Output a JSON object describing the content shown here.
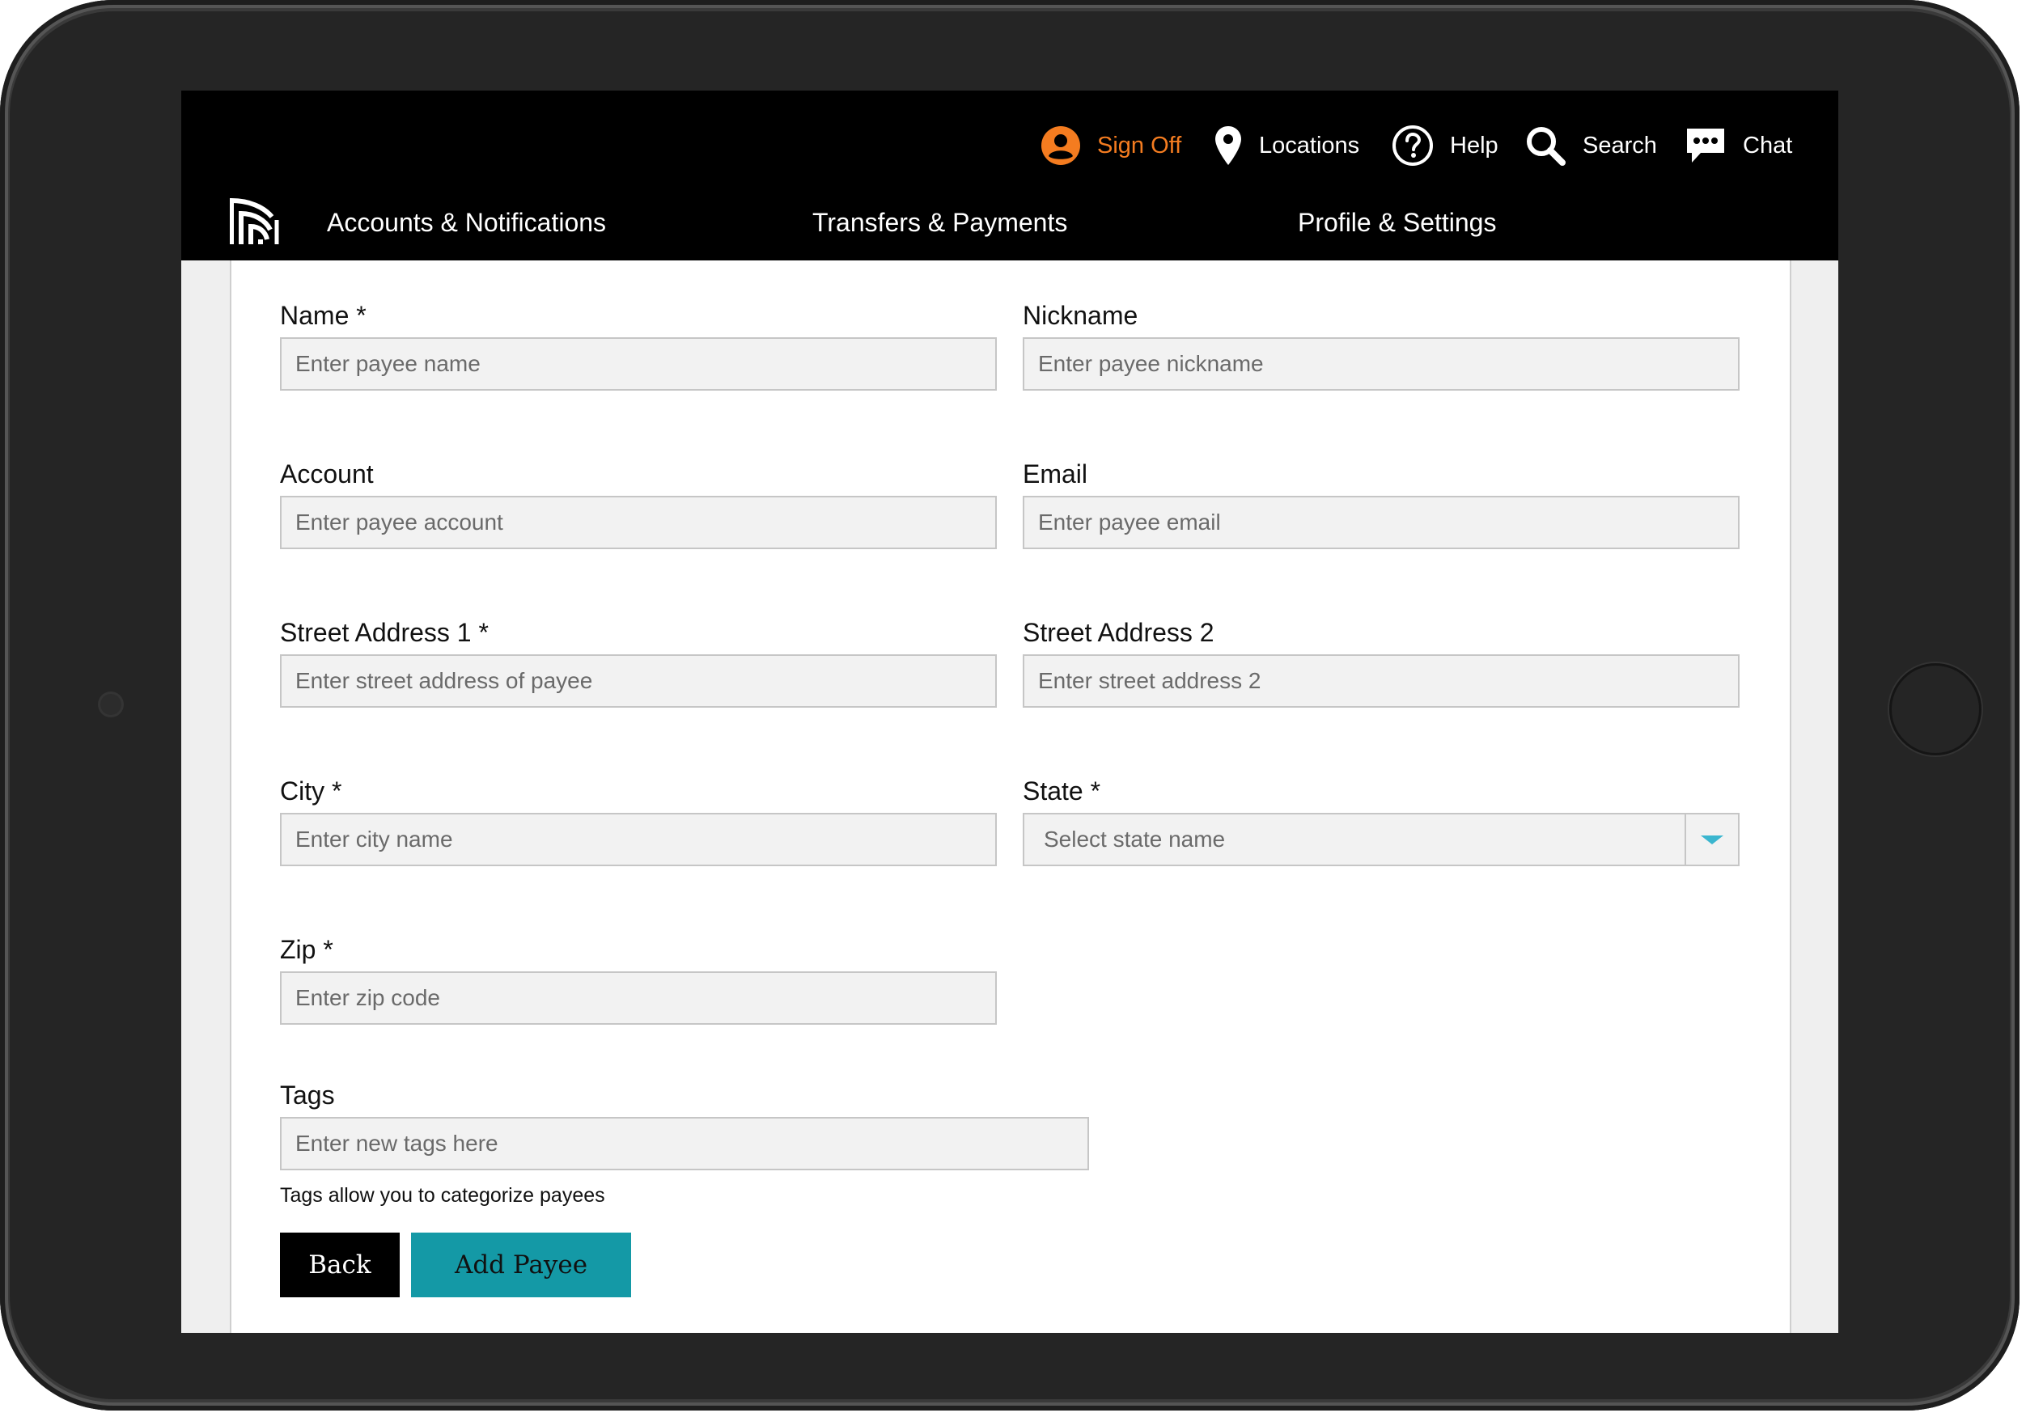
{
  "header": {
    "utility": {
      "sign_off": "Sign Off",
      "locations": "Locations",
      "help": "Help",
      "search": "Search",
      "chat": "Chat"
    },
    "nav": [
      {
        "label": "Accounts & Notifications"
      },
      {
        "label": "Transfers & Payments"
      },
      {
        "label": "Profile & Settings"
      }
    ]
  },
  "form": {
    "name": {
      "label": "Name *",
      "placeholder": "Enter payee name",
      "value": ""
    },
    "nickname": {
      "label": "Nickname",
      "placeholder": "Enter payee nickname",
      "value": ""
    },
    "account": {
      "label": "Account",
      "placeholder": "Enter payee account",
      "value": ""
    },
    "email": {
      "label": "Email",
      "placeholder": "Enter payee email",
      "value": ""
    },
    "street1": {
      "label": "Street Address 1 *",
      "placeholder": "Enter street address of payee",
      "value": ""
    },
    "street2": {
      "label": "Street Address 2",
      "placeholder": "Enter street address 2",
      "value": ""
    },
    "city": {
      "label": "City *",
      "placeholder": "Enter city name",
      "value": ""
    },
    "state": {
      "label": "State *",
      "selected": "Select state name"
    },
    "zip": {
      "label": "Zip *",
      "placeholder": "Enter zip code",
      "value": ""
    },
    "tags": {
      "label": "Tags",
      "placeholder": "Enter new tags here",
      "value": "",
      "hint": "Tags allow you to categorize payees"
    }
  },
  "actions": {
    "back": "Back",
    "add_payee": "Add Payee"
  },
  "colors": {
    "sign_off": "#f47c20",
    "primary_button": "#1499a6",
    "select_arrow": "#3bb6cf",
    "topbar": "#000000"
  },
  "icons": {
    "sign_off": "user-circle-icon",
    "locations": "map-pin-icon",
    "help": "question-circle-icon",
    "search": "magnifier-icon",
    "chat": "speech-bubble-icon",
    "select": "chevron-down-icon"
  }
}
